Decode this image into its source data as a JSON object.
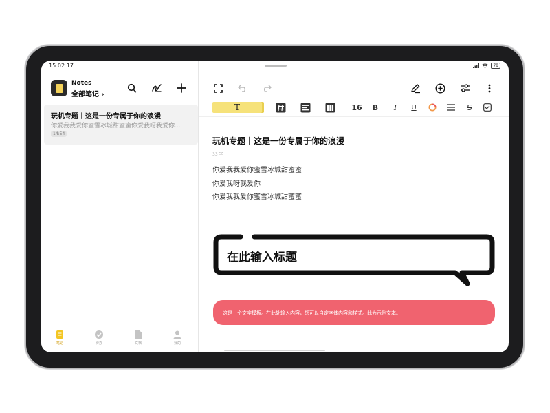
{
  "status_bar": {
    "time": "15:02:17",
    "battery": "78"
  },
  "sidebar": {
    "app_name": "Notes",
    "folder": "全部笔记 ›",
    "tools": [
      "search-icon",
      "handwriting-icon",
      "add-icon"
    ],
    "notes": [
      {
        "title": "玩机专题丨这是一份专属于你的浪漫",
        "preview": "你爱我我爱你蜜雪冰城甜蜜蜜你爱我呀我爱你...",
        "time": "14:54"
      }
    ],
    "bottom_nav": [
      {
        "label": "笔记",
        "icon": "note-icon",
        "active": true
      },
      {
        "label": "待办",
        "icon": "todo-check-icon",
        "active": false
      },
      {
        "label": "文档",
        "icon": "document-icon",
        "active": false
      },
      {
        "label": "我的",
        "icon": "profile-icon",
        "active": false
      }
    ]
  },
  "editor": {
    "toolbar_top": [
      "fullscreen-icon",
      "undo-icon",
      "redo-icon",
      "pen-icon",
      "add-circle-icon",
      "settings-sliders-icon",
      "more-icon"
    ],
    "format_bar": {
      "text_style": "T",
      "font_size": "16",
      "bold": "B",
      "italic": "I",
      "underline": "U",
      "strikethrough": "S"
    },
    "note": {
      "title": "玩机专题丨这是一份专属于你的浪漫",
      "char_count": "33 字",
      "lines": [
        "你爱我我爱你蜜雪冰城甜蜜蜜",
        "你爱我呀我爱你",
        "你爱我我爱你蜜雪冰城甜蜜蜜"
      ]
    },
    "template": {
      "bubble_title": "在此输入标题",
      "banner_text": "这是一个文字模板。在此处输入内容，您可以自定字体内容和样式。此为示例文本。"
    }
  },
  "colors": {
    "accent_yellow": "#f6e27a",
    "banner_red": "#f0636f",
    "nav_active": "#d4a21a"
  }
}
